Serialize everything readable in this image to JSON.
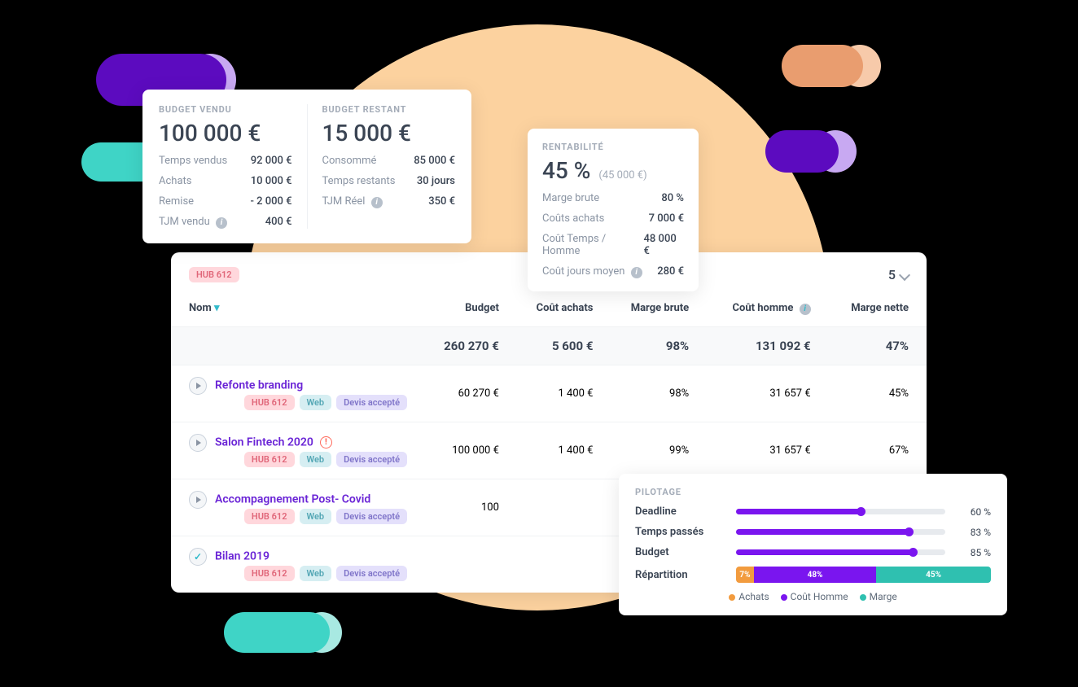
{
  "budget_vendu": {
    "title": "BUDGET VENDU",
    "value": "100 000 €",
    "rows": [
      {
        "label": "Temps vendus",
        "value": "92 000 €"
      },
      {
        "label": "Achats",
        "value": "10 000 €"
      },
      {
        "label": "Remise",
        "value": "- 2 000 €"
      },
      {
        "label": "TJM vendu",
        "value": "400 €",
        "info": true
      }
    ]
  },
  "budget_restant": {
    "title": "BUDGET RESTANT",
    "value": "15 000 €",
    "rows": [
      {
        "label": "Consommé",
        "value": "85 000 €"
      },
      {
        "label": "Temps restants",
        "value": "30 jours"
      },
      {
        "label": "TJM Réel",
        "value": "350 €",
        "info": true
      }
    ]
  },
  "rentabilite": {
    "title": "RENTABILITÉ",
    "value": "45 %",
    "sub": "(45 000 €)",
    "rows": [
      {
        "label": "Marge brute",
        "value": "80 %"
      },
      {
        "label": "Coûts achats",
        "value": "7 000 €"
      },
      {
        "label": "Coût Temps / Homme",
        "value": "48 000 €"
      },
      {
        "label": "Coût jours moyen",
        "value": "280 €",
        "info": true
      }
    ]
  },
  "table": {
    "hub_tag": "HUB 612",
    "page_size": "5",
    "headers": {
      "nom": "Nom",
      "budget": "Budget",
      "cout_achats": "Coût achats",
      "marge_brute": "Marge brute",
      "cout_homme": "Coût homme",
      "marge_nette": "Marge nette"
    },
    "totals": {
      "budget": "260 270 €",
      "cout_achats": "5 600 €",
      "marge_brute": "98%",
      "cout_homme": "131 092 €",
      "marge_nette": "47%"
    },
    "rows": [
      {
        "name": "Refonte branding",
        "alert": false,
        "status": "play",
        "tags": [
          "HUB 612",
          "Web",
          "Devis accepté"
        ],
        "budget": "60 270 €",
        "cout_achats": "1 400 €",
        "marge_brute": "98%",
        "cout_homme": "31 657 €",
        "marge_nette": "45%"
      },
      {
        "name": "Salon Fintech 2020",
        "alert": true,
        "status": "play",
        "tags": [
          "HUB 612",
          "Web",
          "Devis accepté"
        ],
        "budget": "100 000 €",
        "cout_achats": "1 400 €",
        "marge_brute": "99%",
        "cout_homme": "31 657 €",
        "marge_nette": "67%"
      },
      {
        "name": "Accompagnement Post- Covid",
        "alert": false,
        "status": "play",
        "tags": [
          "HUB 612",
          "Web",
          "Devis accepté"
        ],
        "budget": "100",
        "cout_achats": "",
        "marge_brute": "",
        "cout_homme": "",
        "marge_nette": ""
      },
      {
        "name": "Bilan 2019",
        "alert": false,
        "status": "check",
        "tags": [
          "HUB 612",
          "Web",
          "Devis accepté"
        ],
        "budget": "",
        "cout_achats": "",
        "marge_brute": "",
        "cout_homme": "",
        "marge_nette": ""
      }
    ]
  },
  "pilotage": {
    "title": "PILOTAGE",
    "rows": [
      {
        "label": "Deadline",
        "pct": 60,
        "pct_label": "60 %"
      },
      {
        "label": "Temps passés",
        "pct": 83,
        "pct_label": "83 %"
      },
      {
        "label": "Budget",
        "pct": 85,
        "pct_label": "85 %"
      }
    ],
    "repartition_label": "Répartition",
    "repartition": [
      {
        "label": "7%",
        "pct": 7
      },
      {
        "label": "48%",
        "pct": 48
      },
      {
        "label": "45%",
        "pct": 45
      }
    ],
    "legend": [
      {
        "label": "Achats",
        "cls": "a"
      },
      {
        "label": "Coût Homme",
        "cls": "b"
      },
      {
        "label": "Marge",
        "cls": "c"
      }
    ]
  },
  "chart_data": {
    "type": "bar",
    "title": "Répartition",
    "categories": [
      "Achats",
      "Coût Homme",
      "Marge"
    ],
    "values": [
      7,
      48,
      45
    ],
    "progress": {
      "Deadline": 60,
      "Temps passés": 83,
      "Budget": 85
    }
  }
}
